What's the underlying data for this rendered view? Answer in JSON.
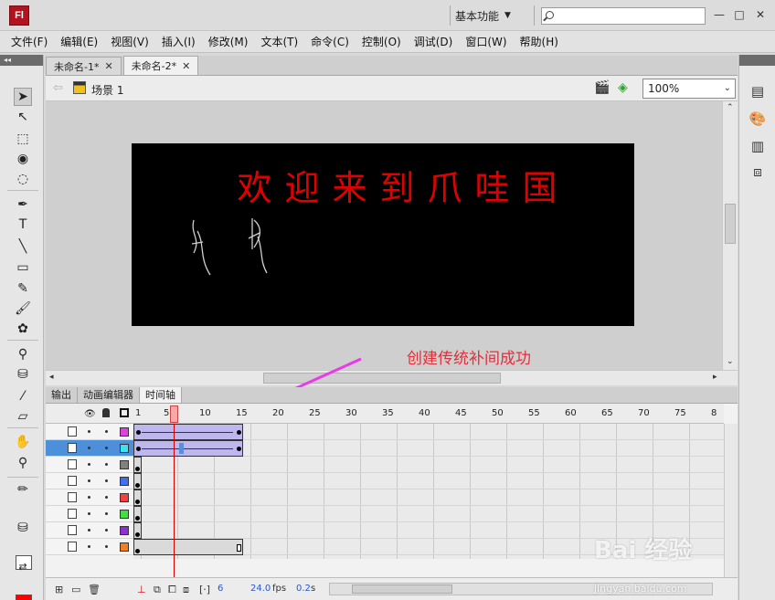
{
  "app": {
    "logo": "Fl",
    "workspace": "基本功能",
    "search_placeholder": "",
    "window_buttons": [
      "—",
      "□",
      "✕"
    ]
  },
  "menu": [
    "文件(F)",
    "编辑(E)",
    "视图(V)",
    "插入(I)",
    "修改(M)",
    "文本(T)",
    "命令(C)",
    "控制(O)",
    "调试(D)",
    "窗口(W)",
    "帮助(H)"
  ],
  "documents": {
    "tabs": [
      {
        "label": "未命名-1*",
        "active": false
      },
      {
        "label": "未命名-2*",
        "active": true
      }
    ]
  },
  "edit_bar": {
    "scene": "场景 1",
    "zoom": "100%"
  },
  "stage": {
    "title": "欢迎来到爪哇国",
    "background": "#000000",
    "text_color": "#e00000"
  },
  "annotation": {
    "text": "创建传统补间成功",
    "color": "#e0303a"
  },
  "bottom_tabs": [
    {
      "label": "输出",
      "active": false
    },
    {
      "label": "动画编辑器",
      "active": false
    },
    {
      "label": "时间轴",
      "active": true
    }
  ],
  "timeline": {
    "ruler": [
      "1",
      "5",
      "10",
      "15",
      "20",
      "25",
      "30",
      "35",
      "40",
      "45",
      "50",
      "55",
      "60",
      "65",
      "70",
      "75",
      "8"
    ],
    "current_frame": 6,
    "layers": [
      {
        "color": "#e040e0",
        "selected": false
      },
      {
        "color": "#40e0f0",
        "selected": true
      },
      {
        "color": "#808080",
        "selected": false
      },
      {
        "color": "#4070f0",
        "selected": false
      },
      {
        "color": "#f04040",
        "selected": false
      },
      {
        "color": "#40e040",
        "selected": false
      },
      {
        "color": "#9030d0",
        "selected": false
      },
      {
        "color": "#f08020",
        "selected": false
      }
    ],
    "footer": {
      "frame": "6",
      "fps": "24.0",
      "fps_unit": "fps",
      "time": "0.2",
      "time_unit": "s"
    }
  },
  "watermark": {
    "text": "Bai 经验",
    "url": "jingyan.baidu.com"
  }
}
